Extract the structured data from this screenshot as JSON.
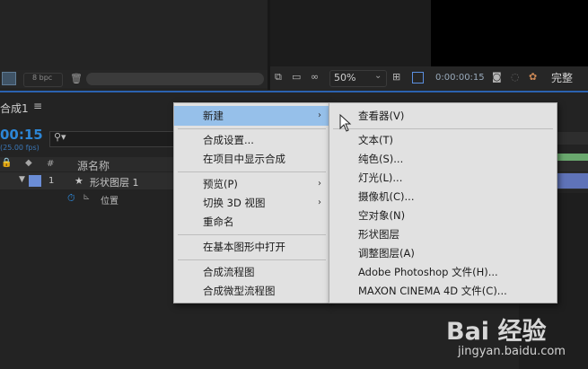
{
  "toolbar_left": {
    "bpc": "8 bpc"
  },
  "toolbar_right": {
    "zoom": "50%",
    "timecode": "0:00:00:15",
    "quality": "完整"
  },
  "timeline": {
    "tab": "合成1",
    "timecode": "00:15",
    "fps": "(25.00 fps)",
    "col_num": "#",
    "col_name": "源名称",
    "layer": {
      "num": "1",
      "name": "形状图层 1"
    },
    "property": "位置"
  },
  "context_menu": {
    "items": [
      "新建",
      "合成设置...",
      "在项目中显示合成",
      "预览(P)",
      "切换 3D 视图",
      "重命名",
      "在基本图形中打开",
      "合成流程图",
      "合成微型流程图"
    ]
  },
  "submenu": {
    "items": [
      "查看器(V)",
      "文本(T)",
      "纯色(S)...",
      "灯光(L)...",
      "摄像机(C)...",
      "空对象(N)",
      "形状图层",
      "调整图层(A)",
      "Adobe Photoshop 文件(H)...",
      "MAXON CINEMA 4D 文件(C)..."
    ]
  },
  "watermark": {
    "brand": "Bai  经验",
    "url": "jingyan.baidu.com"
  },
  "colors": {
    "accent": "#2b62b0",
    "menu_highlight": "#96c0ea",
    "layer_label": "#6b8dd6"
  }
}
